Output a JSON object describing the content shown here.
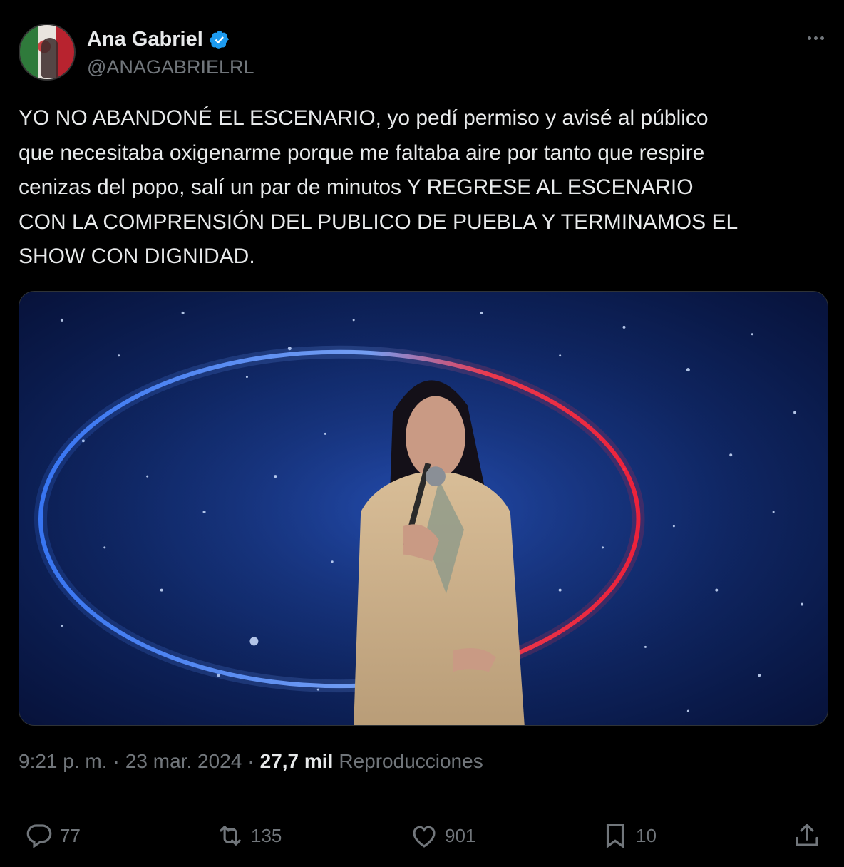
{
  "header": {
    "name": "Ana Gabriel",
    "handle": "@ANAGABRIELRL"
  },
  "tweet": {
    "text": "YO NO ABANDONÉ EL ESCENARIO, yo pedí permiso y avisé al público\nque necesitaba oxigenarme porque me faltaba aire por tanto que respire\ncenizas del popo, salí un par de minutos Y REGRESE AL ESCENARIO\nCON LA COMPRENSIÓN DEL PUBLICO DE PUEBLA Y TERMINAMOS EL\nSHOW CON DIGNIDAD."
  },
  "meta": {
    "time": "9:21 p. m.",
    "sep1": "·",
    "date": "23 mar. 2024",
    "sep2": "·",
    "views_count": "27,7 mil",
    "views_label": "Reproducciones"
  },
  "actions": {
    "replies": "77",
    "reposts": "135",
    "likes": "901",
    "bookmarks": "10"
  },
  "colors": {
    "background": "#000000",
    "text": "#e7e9ea",
    "muted": "#71767b",
    "verified": "#1d9bf0",
    "divider": "#2f3336"
  },
  "icons": [
    "verified-badge-icon",
    "more-options-icon",
    "reply-icon",
    "repost-icon",
    "like-icon",
    "bookmark-icon",
    "share-icon"
  ]
}
